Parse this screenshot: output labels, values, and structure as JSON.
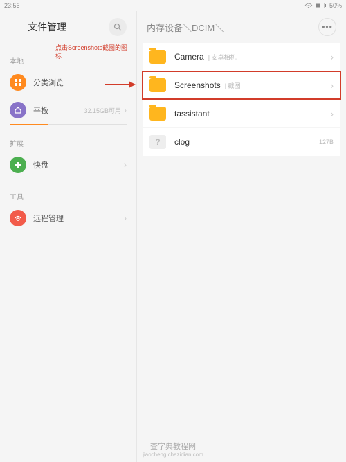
{
  "statusbar": {
    "time": "23:56",
    "battery": "50%"
  },
  "sidebar": {
    "title": "文件管理",
    "note": "点击Screenshots截图的图标",
    "sections": {
      "local": "本地",
      "extension": "扩展",
      "tools": "工具"
    },
    "items": {
      "browse": "分类浏览",
      "tablet": "平板",
      "tablet_meta": "32.15GB可用",
      "fastdisk": "快盘",
      "remote": "远程管理"
    }
  },
  "main": {
    "breadcrumb": "内存设备＼DCIM＼",
    "files": [
      {
        "name": "Camera",
        "sub": "安卓相机",
        "type": "folder",
        "chevron": true
      },
      {
        "name": "Screenshots",
        "sub": "截图",
        "type": "folder",
        "chevron": true,
        "highlighted": true
      },
      {
        "name": "tassistant",
        "sub": "",
        "type": "folder",
        "chevron": true
      },
      {
        "name": "clog",
        "sub": "",
        "type": "file",
        "meta": "127B"
      }
    ]
  },
  "watermark": {
    "main": "查字典教程网",
    "sub": "jiaocheng.chazidian.com"
  },
  "colors": {
    "accent": "#ff8a1f",
    "green": "#4caf50",
    "purple": "#8873c8",
    "red": "#f25b4a"
  }
}
